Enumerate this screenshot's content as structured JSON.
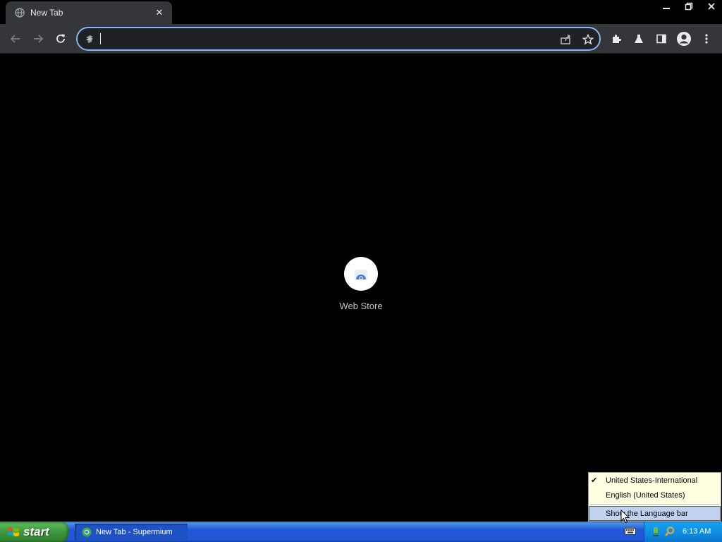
{
  "browser": {
    "tab": {
      "title": "New Tab",
      "close_glyph": "✕"
    },
    "window_controls": {
      "minimize": "▁",
      "restore": "❐",
      "close": "✕"
    },
    "omnibox": {
      "value": "",
      "placeholder": ""
    }
  },
  "content": {
    "shortcuts": [
      {
        "label": "Web Store",
        "icon": "web-store-icon"
      }
    ]
  },
  "context_menu": {
    "items": [
      {
        "label": "United States-International",
        "checked": true
      },
      {
        "label": "English (United States)",
        "checked": false
      },
      {
        "label": "Show the Language bar",
        "highlighted": true
      }
    ],
    "check_glyph": "✔"
  },
  "taskbar": {
    "start_label": "start",
    "task_button": "New Tab - Supermium",
    "clock": "6:13 AM"
  },
  "colors": {
    "omnibox_focus": "#8ab4f8",
    "chrome_toolbar": "#35363a",
    "taskbar_blue": "#2157d7",
    "start_green": "#3b953b",
    "tray_blue": "#0f8be0"
  }
}
